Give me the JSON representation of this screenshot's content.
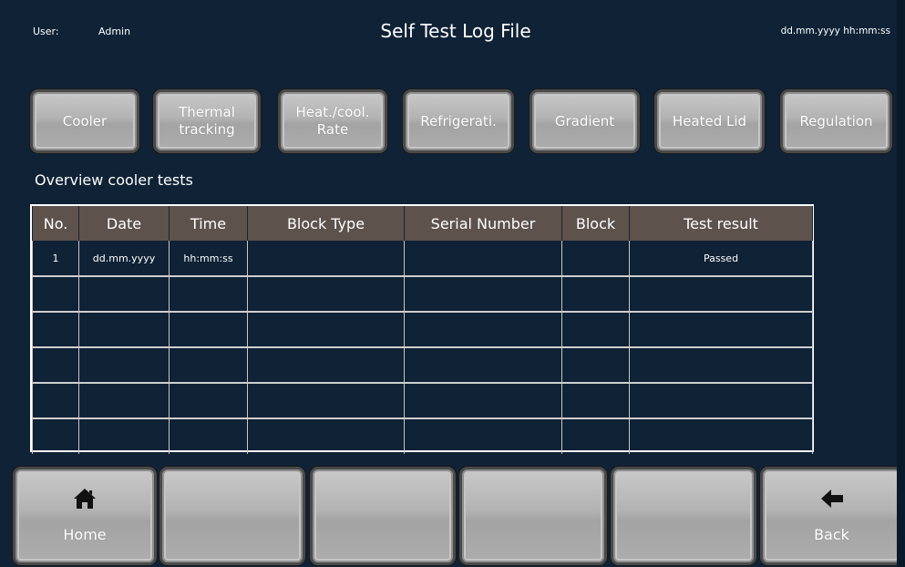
{
  "header": {
    "user_label": "User:",
    "user_name": "Admin",
    "title": "Self Test Log File",
    "datetime": "dd.mm.yyyy  hh:mm:ss"
  },
  "tabs": [
    {
      "label": "Cooler"
    },
    {
      "label": "Thermal\ntracking"
    },
    {
      "label": "Heat./cool.\nRate"
    },
    {
      "label": "Refrigerati."
    },
    {
      "label": "Gradient"
    },
    {
      "label": "Heated Lid"
    },
    {
      "label": "Regulation"
    }
  ],
  "section_title": "Overview cooler tests",
  "table": {
    "headers": [
      "No.",
      "Date",
      "Time",
      "Block Type",
      "Serial Number",
      "Block",
      "Test result"
    ],
    "rows": [
      [
        "1",
        "dd.mm.yyyy",
        "hh:mm:ss",
        "",
        "",
        "",
        "Passed"
      ],
      [
        "",
        "",
        "",
        "",
        "",
        "",
        ""
      ],
      [
        "",
        "",
        "",
        "",
        "",
        "",
        ""
      ],
      [
        "",
        "",
        "",
        "",
        "",
        "",
        ""
      ],
      [
        "",
        "",
        "",
        "",
        "",
        "",
        ""
      ],
      [
        "",
        "",
        "",
        "",
        "",
        "",
        ""
      ]
    ]
  },
  "bottom": {
    "home_label": "Home",
    "back_label": "Back",
    "home_icon": "home-icon",
    "back_icon": "arrow-left-icon"
  },
  "colors": {
    "background": "#0f2236",
    "table_header": "#5e524d",
    "button_face": "#b2b2b2"
  }
}
